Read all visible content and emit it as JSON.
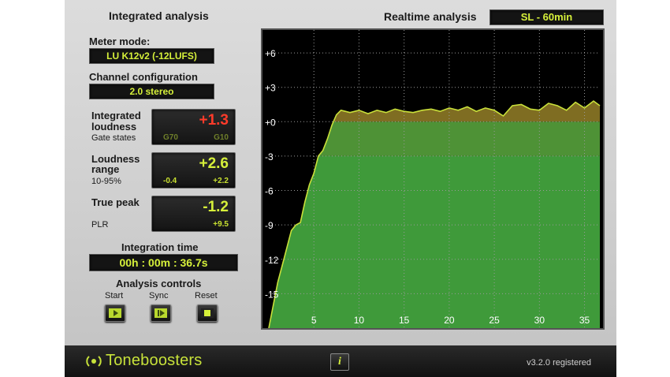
{
  "integrated": {
    "title": "Integrated analysis",
    "meter_mode_label": "Meter mode:",
    "meter_mode_value": "LU K12v2 (-12LUFS)",
    "channel_label": "Channel configuration",
    "channel_value": "2.0 stereo",
    "loudness_label_1": "Integrated",
    "loudness_label_2": "loudness",
    "gate_label": "Gate states",
    "loudness_value": "+1.3",
    "gate_g70": "G70",
    "gate_g10": "G10",
    "range_label_1": "Loudness",
    "range_label_2": "range",
    "range_sub": "10-95%",
    "range_value": "+2.6",
    "range_low": "-0.4",
    "range_high": "+2.2",
    "peak_label": "True peak",
    "plr_label": "PLR",
    "peak_value": "-1.2",
    "plr_value": "+9.5",
    "time_label": "Integration time",
    "time_value": "00h : 00m : 36.7s",
    "controls_label": "Analysis controls",
    "start_label": "Start",
    "sync_label": "Sync",
    "reset_label": "Reset"
  },
  "realtime": {
    "title": "Realtime analysis",
    "mode_value": "SL - 60min"
  },
  "footer": {
    "brand": "Toneboosters",
    "info_label": "i",
    "version": "v3.2.0 registered"
  },
  "colors": {
    "lcd_text": "#d6f03a",
    "loudness_red": "#ff3b2a",
    "graph_fill_green": "#3f9a3a",
    "graph_fill_olive": "#8a7a2a"
  },
  "chart_data": {
    "type": "area",
    "x_ticks": [
      5,
      10,
      15,
      20,
      25,
      30,
      35
    ],
    "y_ticks": [
      "+6",
      "+3",
      "+0",
      "-3",
      "-6",
      "-9",
      "-12",
      "-15"
    ],
    "xlim": [
      0,
      36.7
    ],
    "ylim": [
      -18,
      8
    ],
    "grid": true,
    "x": [
      0,
      0.5,
      1,
      1.5,
      2,
      2.5,
      3,
      3.5,
      4,
      4.5,
      5,
      5.5,
      6,
      6.5,
      7,
      7.5,
      8,
      9,
      10,
      11,
      12,
      13,
      14,
      15,
      16,
      17,
      18,
      19,
      20,
      21,
      22,
      23,
      24,
      25,
      26,
      27,
      28,
      29,
      30,
      31,
      32,
      33,
      34,
      35,
      36,
      36.7
    ],
    "y": [
      -18,
      -16,
      -14,
      -12.5,
      -11,
      -9.5,
      -9,
      -8.8,
      -7,
      -5.5,
      -4.5,
      -3,
      -2.5,
      -1.5,
      -0.3,
      0.6,
      1.0,
      0.8,
      1.0,
      0.7,
      1.0,
      0.8,
      1.1,
      0.9,
      0.8,
      1.0,
      1.1,
      0.9,
      1.2,
      1.0,
      1.3,
      0.9,
      1.2,
      1.0,
      0.5,
      1.4,
      1.5,
      1.1,
      1.0,
      1.6,
      1.4,
      1.0,
      1.7,
      1.2,
      1.8,
      1.4
    ],
    "bands": [
      {
        "name": "upper",
        "from": -3,
        "to": 0,
        "color": "#4e9236"
      },
      {
        "name": "lower",
        "from": -18,
        "to": -3,
        "color": "#3f9a3a"
      }
    ]
  }
}
